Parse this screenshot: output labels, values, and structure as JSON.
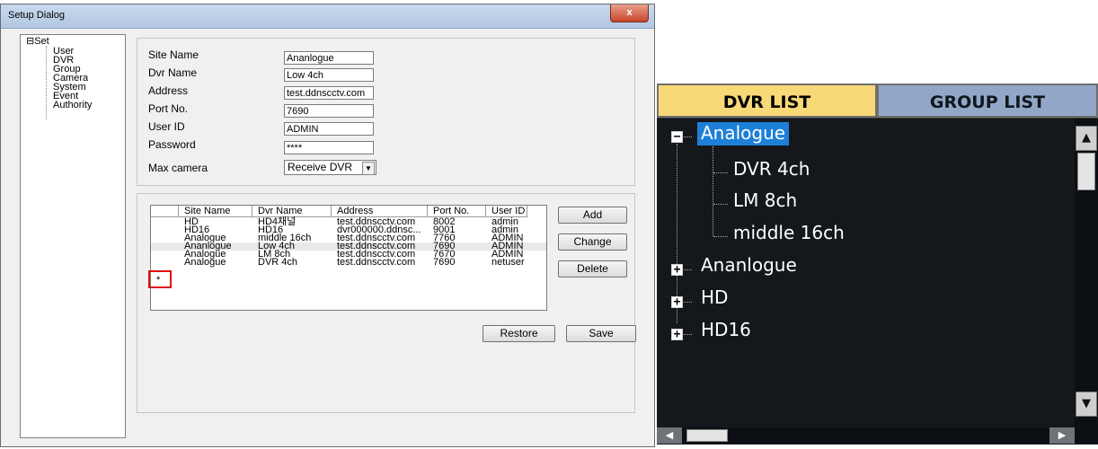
{
  "dialog": {
    "title": "Setup Dialog",
    "close_label": "x",
    "tree": {
      "root_toggle": "⊟",
      "root": "Set",
      "items": [
        "User",
        "DVR",
        "Group",
        "Camera",
        "System",
        "Event",
        "Authority"
      ]
    },
    "form": {
      "site_name": {
        "label": "Site Name",
        "value": "Ananlogue"
      },
      "dvr_name": {
        "label": "Dvr Name",
        "value": "Low 4ch"
      },
      "address": {
        "label": "Address",
        "value": "test.ddnscctv.com"
      },
      "port": {
        "label": "Port No.",
        "value": "7690"
      },
      "user_id": {
        "label": "User ID",
        "value": "ADMIN"
      },
      "password": {
        "label": "Password",
        "value": "****"
      },
      "max_camera": {
        "label": "Max camera",
        "value": "Receive DVR"
      }
    },
    "table": {
      "columns": [
        "Site Name",
        "Dvr Name",
        "Address",
        "Port No.",
        "User ID"
      ],
      "rows": [
        [
          "HD",
          "HD4채널",
          "test.ddnscctv.com",
          "8002",
          "admin"
        ],
        [
          "HD16",
          "HD16",
          "dvr000000.ddnsc...",
          "9001",
          "admin"
        ],
        [
          "Analogue",
          "middle 16ch",
          "test.ddnscctv.com",
          "7760",
          "ADMIN"
        ],
        [
          "Ananlogue",
          "Low 4ch",
          "test.ddnscctv.com",
          "7690",
          "ADMIN"
        ],
        [
          "Analogue",
          "LM 8ch",
          "test.ddnscctv.com",
          "7670",
          "ADMIN"
        ],
        [
          "Analogue",
          "DVR 4ch",
          "test.ddnscctv.com",
          "7690",
          "netuser"
        ]
      ],
      "new_row_marker": "*"
    },
    "buttons": {
      "add": "Add",
      "change": "Change",
      "delete": "Delete",
      "restore": "Restore",
      "save": "Save"
    }
  },
  "dvr_panel": {
    "tabs": [
      "DVR LIST",
      "GROUP LIST"
    ],
    "active_tab": "DVR LIST",
    "tree": [
      {
        "label": "Analogue",
        "expanded": true,
        "selected": true,
        "toggle": "−",
        "children": [
          "DVR 4ch",
          "LM 8ch",
          "middle 16ch"
        ]
      },
      {
        "label": "Ananlogue",
        "expanded": false,
        "toggle": "+"
      },
      {
        "label": "HD",
        "expanded": false,
        "toggle": "+"
      },
      {
        "label": "HD16",
        "expanded": false,
        "toggle": "+"
      }
    ],
    "colors": {
      "background": "#14181d",
      "active_tab": "#f8d978",
      "inactive_tab": "#92a7c7",
      "selection": "#1e7fd8",
      "text": "#ffffff"
    }
  }
}
